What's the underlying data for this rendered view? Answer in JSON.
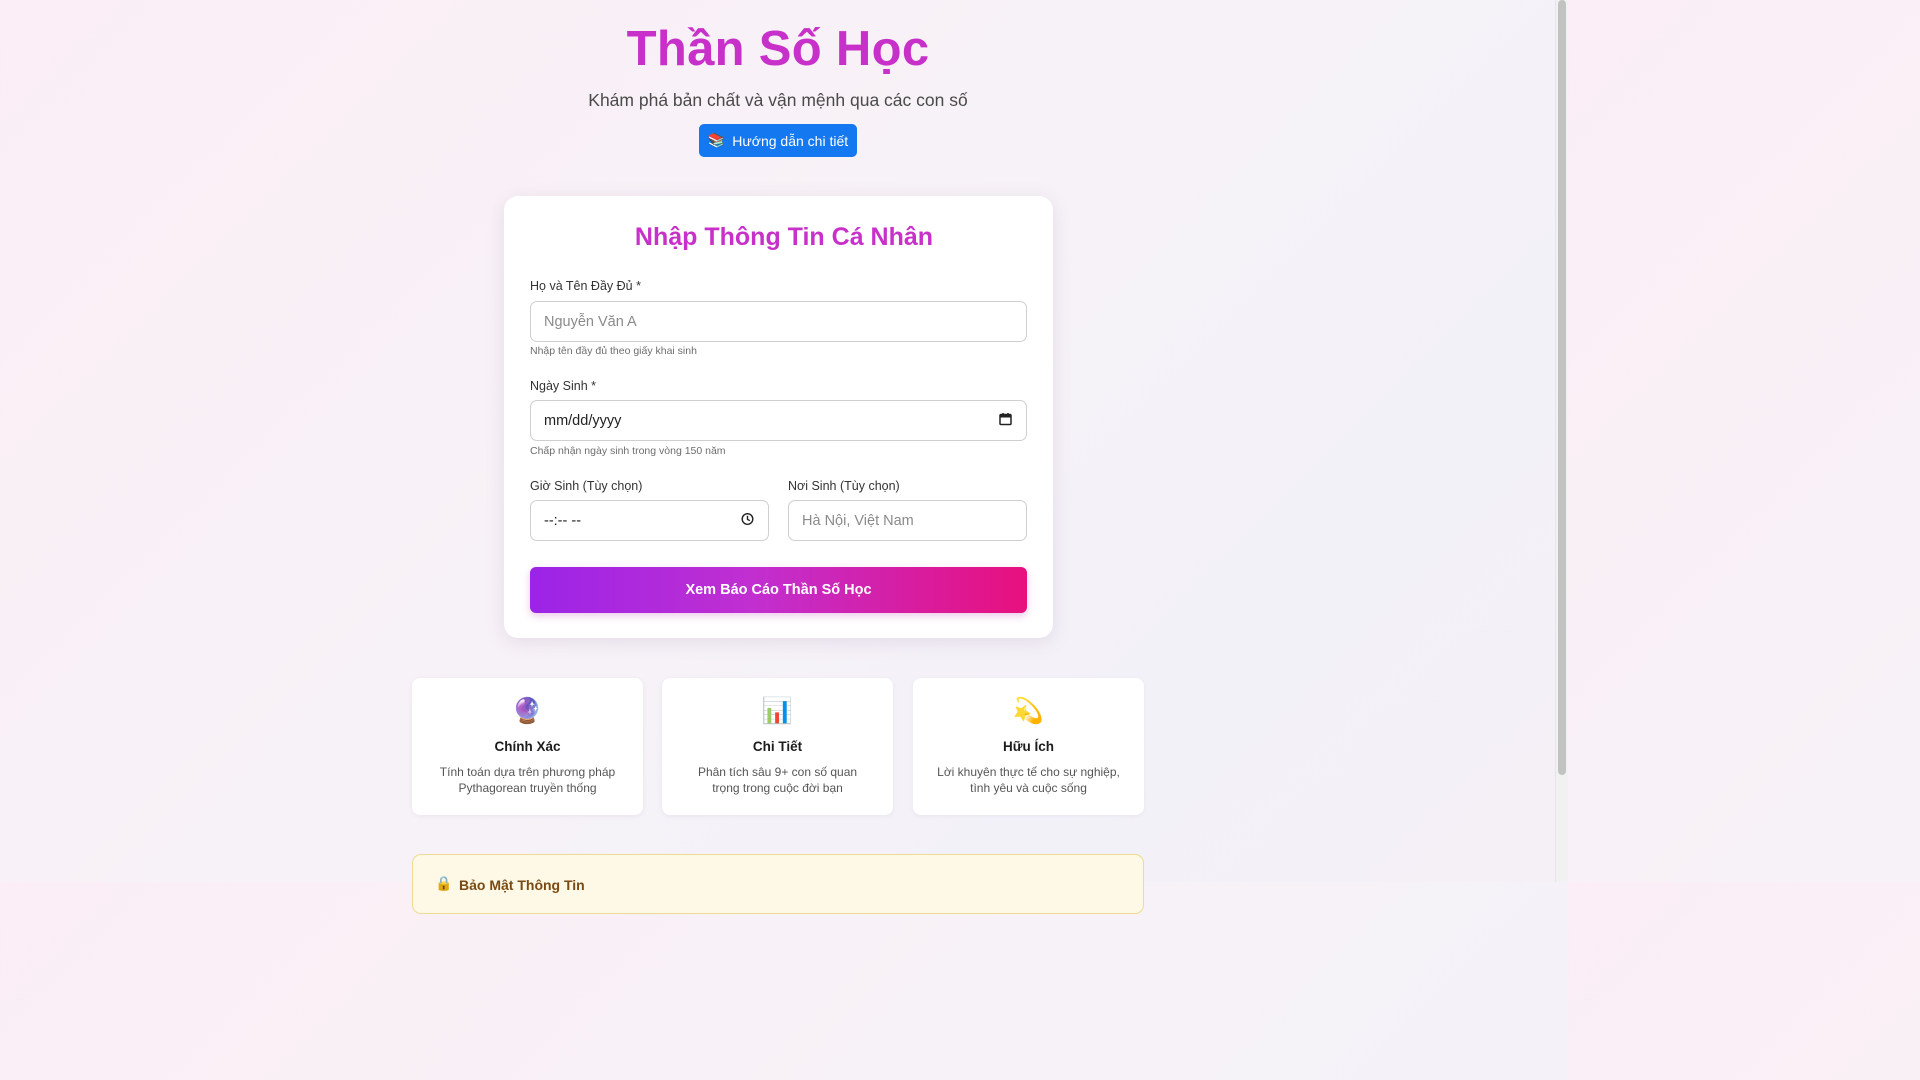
{
  "header": {
    "title": "Thần Số Học",
    "subtitle": "Khám phá bản chất và vận mệnh qua các con số",
    "guide_button": {
      "icon": "books-icon",
      "icon_glyph": "📚",
      "label": "Hướng dẫn chi tiết"
    }
  },
  "form": {
    "title": "Nhập Thông Tin Cá Nhân",
    "full_name": {
      "label": "Họ và Tên Đầy Đủ *",
      "placeholder": "Nguyễn Văn A",
      "hint": "Nhập tên đầy đủ theo giấy khai sinh"
    },
    "birth_date": {
      "label": "Ngày Sinh *",
      "value": "mm/dd/yyyy",
      "hint": "Chấp nhận ngày sinh trong vòng 150 năm"
    },
    "birth_time": {
      "label": "Giờ Sinh (Tùy chọn)",
      "value": "--:-- --"
    },
    "birth_place": {
      "label": "Nơi Sinh (Tùy chọn)",
      "placeholder": "Hà Nội, Việt Nam"
    },
    "submit_label": "Xem Báo Cáo Thần Số Học"
  },
  "features": [
    {
      "icon": "crystal-ball-icon",
      "glyph": "🔮",
      "title": "Chính Xác",
      "description": "Tính toán dựa trên phương pháp Pythagorean truyền thống"
    },
    {
      "icon": "bar-chart-icon",
      "glyph": "📊",
      "title": "Chi Tiết",
      "description": "Phân tích sâu 9+ con số quan trọng trong cuộc đời bạn"
    },
    {
      "icon": "dizzy-star-icon",
      "glyph": "💫",
      "title": "Hữu Ích",
      "description": "Lời khuyên thực tế cho sự nghiệp, tình yêu và cuộc sống"
    }
  ],
  "security": {
    "icon": "lock-icon",
    "glyph": "🔒",
    "title": "Bảo Mật Thông Tin"
  },
  "colors": {
    "accent": "#c831c9",
    "button_blue": "#1478f0",
    "gradient_start": "#9b24e8",
    "gradient_end": "#e8107e"
  }
}
